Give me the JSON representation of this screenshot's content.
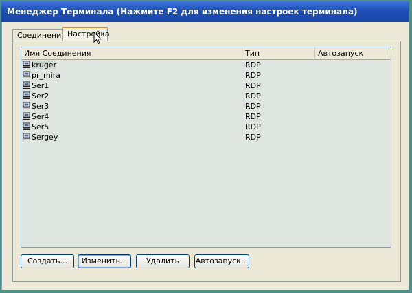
{
  "window": {
    "title": "Менеджер Терминала (Нажмите F2 для изменения настроек терминала)"
  },
  "tabs": [
    {
      "label": "Соединения",
      "active": false
    },
    {
      "label": "Настройка",
      "active": true
    }
  ],
  "list": {
    "columns": [
      "Имя Соединения",
      "Тип",
      "Автозапуск"
    ],
    "rows": [
      {
        "name": "kruger",
        "type": "RDP",
        "autostart": ""
      },
      {
        "name": "pr_mira",
        "type": "RDP",
        "autostart": ""
      },
      {
        "name": "Ser1",
        "type": "RDP",
        "autostart": ""
      },
      {
        "name": "Ser2",
        "type": "RDP",
        "autostart": ""
      },
      {
        "name": "Ser3",
        "type": "RDP",
        "autostart": ""
      },
      {
        "name": "Ser4",
        "type": "RDP",
        "autostart": ""
      },
      {
        "name": "Ser5",
        "type": "RDP",
        "autostart": ""
      },
      {
        "name": "Sergey",
        "type": "RDP",
        "autostart": ""
      }
    ]
  },
  "buttons": {
    "create": "Создать...",
    "edit": "Изменить...",
    "delete": "Удалить",
    "autostart": "Автозапуск..."
  },
  "icons": {
    "connection": "computer-icon",
    "pointer": "cursor-icon"
  },
  "colors": {
    "title_bar": "#1f4fb7",
    "desktop": "#4f8f87",
    "list_background": "#dfe6e1",
    "active_tab_accent": "#e68b2c"
  }
}
